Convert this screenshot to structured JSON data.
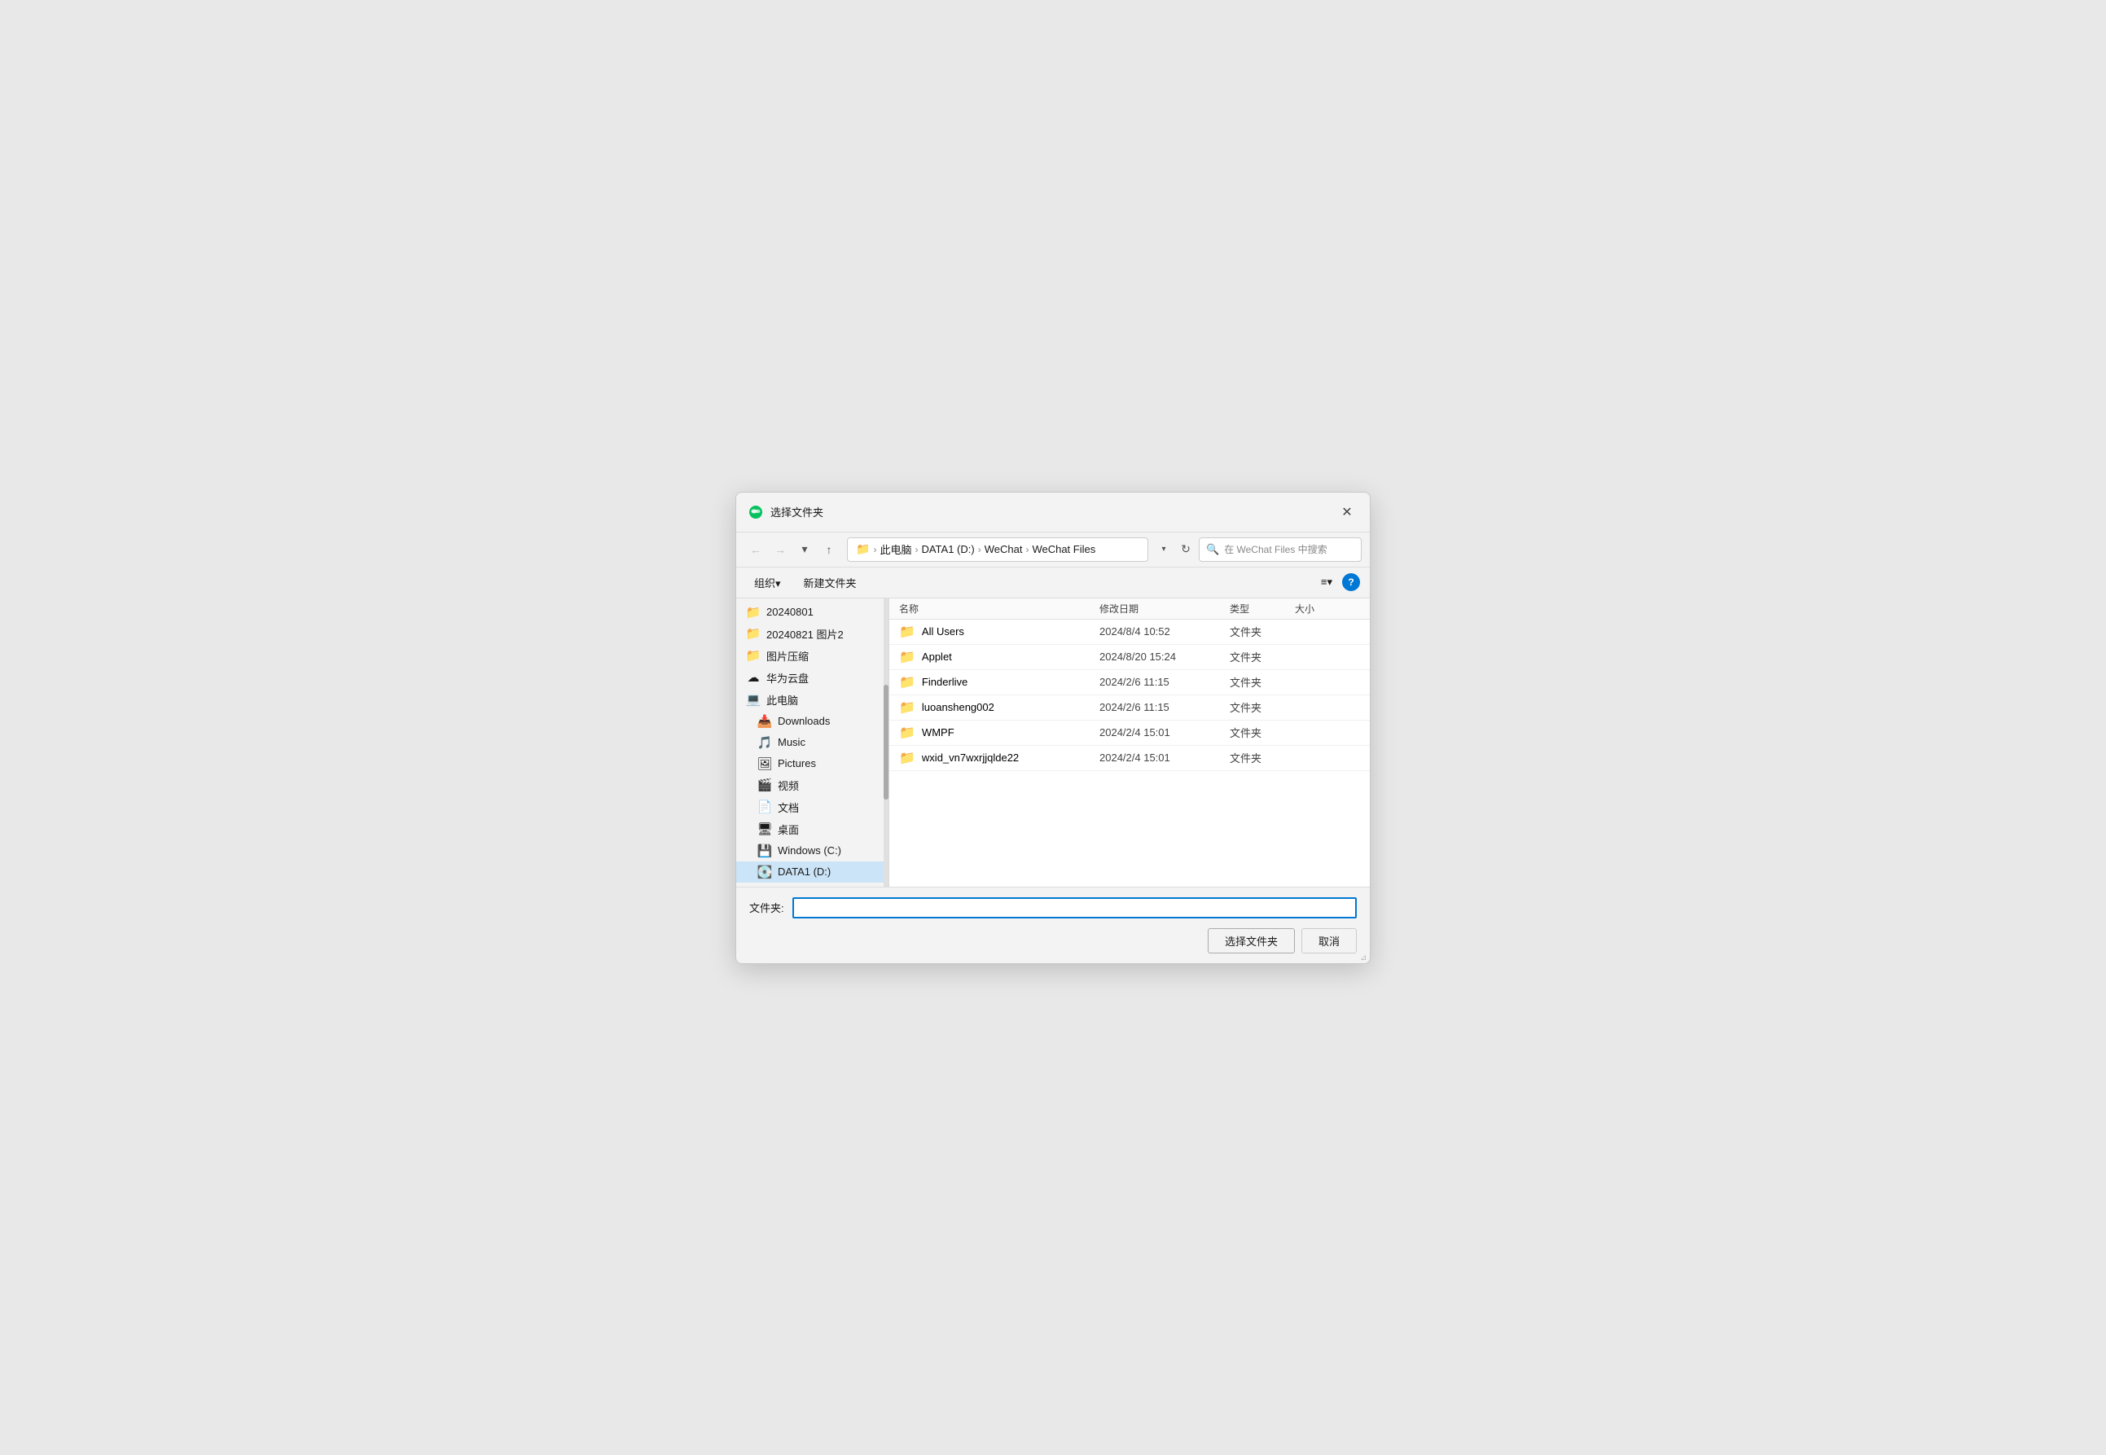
{
  "dialog": {
    "title": "选择文件夹",
    "close_label": "✕"
  },
  "toolbar": {
    "back_label": "←",
    "forward_label": "→",
    "dropdown_label": "▾",
    "up_label": "↑",
    "refresh_label": "↻",
    "search_placeholder": "在 WeChat Files 中搜索",
    "breadcrumb": {
      "parts": [
        "此电脑",
        "DATA1 (D:)",
        "WeChat",
        "WeChat Files"
      ]
    }
  },
  "actionbar": {
    "organize_label": "组织▾",
    "new_folder_label": "新建文件夹",
    "view_label": "≡▾",
    "help_label": "?"
  },
  "sidebar": {
    "items": [
      {
        "id": "20240801",
        "label": "20240801",
        "icon": "folder-yellow",
        "indent": 0
      },
      {
        "id": "20240821",
        "label": "20240821 图片2",
        "icon": "folder-yellow",
        "indent": 0
      },
      {
        "id": "图片压缩",
        "label": "图片压缩",
        "icon": "folder-yellow",
        "indent": 0
      },
      {
        "id": "huawei-cloud",
        "label": "华为云盘",
        "icon": "folder-cloud",
        "indent": 0
      },
      {
        "id": "this-pc",
        "label": "此电脑",
        "icon": "folder-pc",
        "indent": 0
      },
      {
        "id": "downloads",
        "label": "Downloads",
        "icon": "folder-downloads",
        "indent": 1
      },
      {
        "id": "music",
        "label": "Music",
        "icon": "folder-music",
        "indent": 1
      },
      {
        "id": "pictures",
        "label": "Pictures",
        "icon": "folder-pictures",
        "indent": 1
      },
      {
        "id": "video",
        "label": "视频",
        "icon": "folder-video",
        "indent": 1
      },
      {
        "id": "docs",
        "label": "文档",
        "icon": "folder-docs",
        "indent": 1
      },
      {
        "id": "desktop",
        "label": "桌面",
        "icon": "folder-desktop",
        "indent": 1
      },
      {
        "id": "winc",
        "label": "Windows (C:)",
        "icon": "folder-winc",
        "indent": 1
      },
      {
        "id": "data1",
        "label": "DATA1 (D:)",
        "icon": "folder-data1",
        "indent": 1,
        "selected": true
      }
    ]
  },
  "file_list": {
    "headers": [
      "名称",
      "修改日期",
      "类型",
      "大小"
    ],
    "rows": [
      {
        "name": "All Users",
        "date": "2024/8/4 10:52",
        "type": "文件夹",
        "size": ""
      },
      {
        "name": "Applet",
        "date": "2024/8/20 15:24",
        "type": "文件夹",
        "size": ""
      },
      {
        "name": "Finderlive",
        "date": "2024/2/6 11:15",
        "type": "文件夹",
        "size": ""
      },
      {
        "name": "luoansheng002",
        "date": "2024/2/6 11:15",
        "type": "文件夹",
        "size": ""
      },
      {
        "name": "WMPF",
        "date": "2024/2/4 15:01",
        "type": "文件夹",
        "size": ""
      },
      {
        "name": "wxid_vn7wxrjjqlde22",
        "date": "2024/2/4 15:01",
        "type": "文件夹",
        "size": ""
      }
    ]
  },
  "footer": {
    "folder_label": "文件夹:",
    "folder_value": "",
    "select_btn": "选择文件夹",
    "cancel_btn": "取消"
  }
}
